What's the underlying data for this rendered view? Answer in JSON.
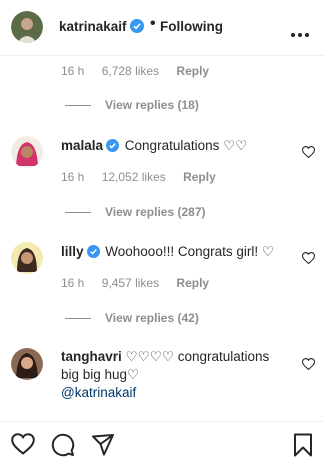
{
  "header": {
    "username": "katrinakaif",
    "separator": "•",
    "follow_status": "Following"
  },
  "top_meta": {
    "time": "16 h",
    "likes": "6,728 likes",
    "reply": "Reply"
  },
  "top_view_replies": "View replies (18)",
  "comments": [
    {
      "username": "malala",
      "text": "Congratulations ♡♡",
      "time": "16 h",
      "likes": "12,052 likes",
      "reply": "Reply",
      "view_replies": "View replies (287)"
    },
    {
      "username": "lilly",
      "text": "Woohooo!!! Congrats girl! ♡",
      "time": "16 h",
      "likes": "9,457 likes",
      "reply": "Reply",
      "view_replies": "View replies (42)"
    },
    {
      "username": "tanghavri",
      "text": "♡♡♡♡ congratulations big big hug♡",
      "mention": "@katrinakaif"
    }
  ],
  "colors": {
    "verified": "#3897f0",
    "muted": "#8e8e8e",
    "text": "#262626",
    "mention": "#00376b"
  },
  "icons": [
    "verified-badge-icon",
    "more-options-icon",
    "heart-outline-icon",
    "comment-icon",
    "share-icon",
    "bookmark-icon"
  ]
}
